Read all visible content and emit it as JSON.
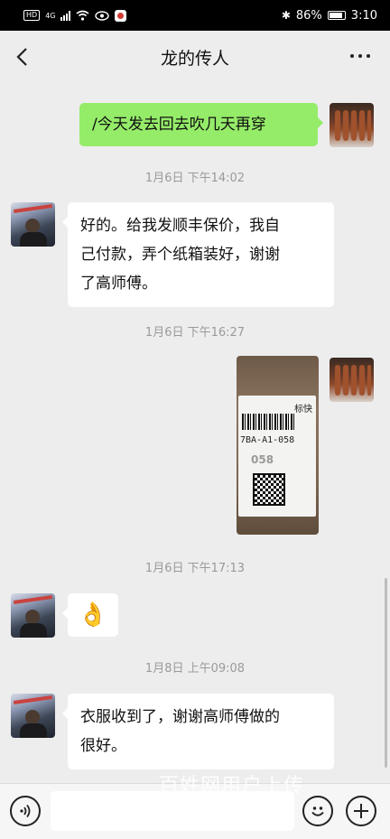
{
  "status_bar": {
    "network": "HD",
    "signal": "4G",
    "battery": "86%",
    "time": "3:10"
  },
  "header": {
    "title": "龙的传人"
  },
  "messages": [
    {
      "side": "right",
      "type": "text",
      "text": "/今天发去回去吹几天再穿"
    },
    {
      "type": "timestamp",
      "text": "1月6日 下午14:02"
    },
    {
      "side": "left",
      "type": "text",
      "lines": [
        "好的。给我发顺丰保价，我自",
        "己付款，弄个纸箱装好，谢谢",
        "了高师傅。"
      ]
    },
    {
      "type": "timestamp",
      "text": "1月6日 下午16:27"
    },
    {
      "side": "right",
      "type": "image",
      "label_code": "7BA-A1-058",
      "label_tag": "标快",
      "label_num": "058"
    },
    {
      "type": "timestamp",
      "text": "1月6日 下午17:13"
    },
    {
      "side": "left",
      "type": "emoji",
      "emoji": "👌"
    },
    {
      "type": "timestamp",
      "text": "1月8日 上午09:08"
    },
    {
      "side": "left",
      "type": "text",
      "lines": [
        "衣服收到了，谢谢高师傅做的",
        "很好。"
      ]
    }
  ],
  "input_bar": {
    "placeholder": "",
    "voice_icon": "voice-icon",
    "emoji_icon": "emoji-icon",
    "plus_icon": "plus-icon"
  },
  "watermark": "百姓网用户上传",
  "colors": {
    "background": "#ededed",
    "self_bubble": "#95ec69",
    "other_bubble": "#ffffff"
  }
}
